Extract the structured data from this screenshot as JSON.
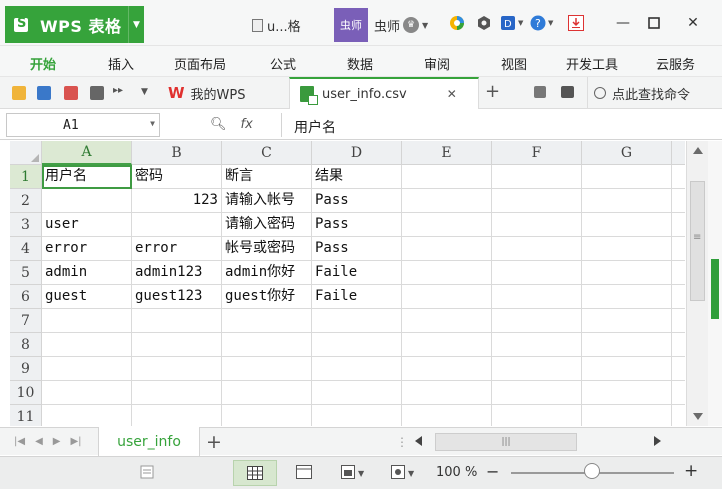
{
  "app": {
    "name": "WPS 表格",
    "doc_tab_short": "u...格",
    "user_avatar_text": "虫师",
    "user_name": "虫师"
  },
  "ribbon_tabs": [
    "开始",
    "插入",
    "页面布局",
    "公式",
    "数据",
    "审阅",
    "视图",
    "开发工具",
    "云服务"
  ],
  "file_tabs": {
    "wps_tab": "我的WPS",
    "csv_tab": "user_info.csv"
  },
  "find_command": "点此查找命令",
  "formula": {
    "name_box": "A1",
    "fx_label": "fx",
    "value": "用户名"
  },
  "columns": [
    "A",
    "B",
    "C",
    "D",
    "E",
    "F",
    "G"
  ],
  "rows": [
    "1",
    "2",
    "3",
    "4",
    "5",
    "6",
    "7",
    "8",
    "9",
    "10",
    "11"
  ],
  "cells": [
    [
      "用户名",
      "密码",
      "断言",
      "结果"
    ],
    [
      "",
      "123",
      "请输入帐号",
      "Pass"
    ],
    [
      "user",
      "",
      "请输入密码",
      "Pass"
    ],
    [
      "error",
      "error",
      "帐号或密码",
      "Pass"
    ],
    [
      "admin",
      "admin123",
      "admin你好",
      "Faile"
    ],
    [
      "guest",
      "guest123",
      "guest你好",
      "Faile"
    ]
  ],
  "sheet": {
    "name": "user_info"
  },
  "status": {
    "zoom": "100 %"
  },
  "colors": {
    "accent": "#36a33b",
    "selected_header": "#dce9d3"
  }
}
